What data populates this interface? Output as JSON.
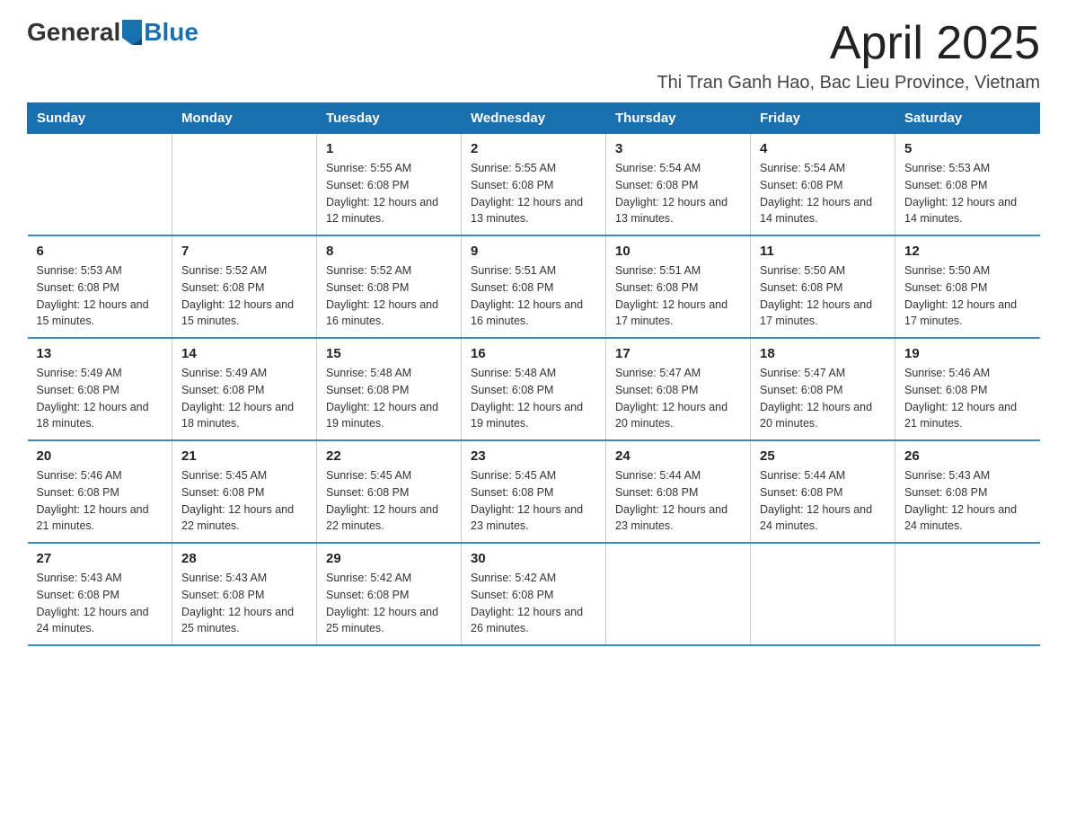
{
  "logo": {
    "general": "General",
    "blue": "Blue"
  },
  "header": {
    "month_title": "April 2025",
    "location": "Thi Tran Ganh Hao, Bac Lieu Province, Vietnam"
  },
  "days_of_week": [
    "Sunday",
    "Monday",
    "Tuesday",
    "Wednesday",
    "Thursday",
    "Friday",
    "Saturday"
  ],
  "weeks": [
    [
      {
        "day": "",
        "sunrise": "",
        "sunset": "",
        "daylight": ""
      },
      {
        "day": "",
        "sunrise": "",
        "sunset": "",
        "daylight": ""
      },
      {
        "day": "1",
        "sunrise": "Sunrise: 5:55 AM",
        "sunset": "Sunset: 6:08 PM",
        "daylight": "Daylight: 12 hours and 12 minutes."
      },
      {
        "day": "2",
        "sunrise": "Sunrise: 5:55 AM",
        "sunset": "Sunset: 6:08 PM",
        "daylight": "Daylight: 12 hours and 13 minutes."
      },
      {
        "day": "3",
        "sunrise": "Sunrise: 5:54 AM",
        "sunset": "Sunset: 6:08 PM",
        "daylight": "Daylight: 12 hours and 13 minutes."
      },
      {
        "day": "4",
        "sunrise": "Sunrise: 5:54 AM",
        "sunset": "Sunset: 6:08 PM",
        "daylight": "Daylight: 12 hours and 14 minutes."
      },
      {
        "day": "5",
        "sunrise": "Sunrise: 5:53 AM",
        "sunset": "Sunset: 6:08 PM",
        "daylight": "Daylight: 12 hours and 14 minutes."
      }
    ],
    [
      {
        "day": "6",
        "sunrise": "Sunrise: 5:53 AM",
        "sunset": "Sunset: 6:08 PM",
        "daylight": "Daylight: 12 hours and 15 minutes."
      },
      {
        "day": "7",
        "sunrise": "Sunrise: 5:52 AM",
        "sunset": "Sunset: 6:08 PM",
        "daylight": "Daylight: 12 hours and 15 minutes."
      },
      {
        "day": "8",
        "sunrise": "Sunrise: 5:52 AM",
        "sunset": "Sunset: 6:08 PM",
        "daylight": "Daylight: 12 hours and 16 minutes."
      },
      {
        "day": "9",
        "sunrise": "Sunrise: 5:51 AM",
        "sunset": "Sunset: 6:08 PM",
        "daylight": "Daylight: 12 hours and 16 minutes."
      },
      {
        "day": "10",
        "sunrise": "Sunrise: 5:51 AM",
        "sunset": "Sunset: 6:08 PM",
        "daylight": "Daylight: 12 hours and 17 minutes."
      },
      {
        "day": "11",
        "sunrise": "Sunrise: 5:50 AM",
        "sunset": "Sunset: 6:08 PM",
        "daylight": "Daylight: 12 hours and 17 minutes."
      },
      {
        "day": "12",
        "sunrise": "Sunrise: 5:50 AM",
        "sunset": "Sunset: 6:08 PM",
        "daylight": "Daylight: 12 hours and 17 minutes."
      }
    ],
    [
      {
        "day": "13",
        "sunrise": "Sunrise: 5:49 AM",
        "sunset": "Sunset: 6:08 PM",
        "daylight": "Daylight: 12 hours and 18 minutes."
      },
      {
        "day": "14",
        "sunrise": "Sunrise: 5:49 AM",
        "sunset": "Sunset: 6:08 PM",
        "daylight": "Daylight: 12 hours and 18 minutes."
      },
      {
        "day": "15",
        "sunrise": "Sunrise: 5:48 AM",
        "sunset": "Sunset: 6:08 PM",
        "daylight": "Daylight: 12 hours and 19 minutes."
      },
      {
        "day": "16",
        "sunrise": "Sunrise: 5:48 AM",
        "sunset": "Sunset: 6:08 PM",
        "daylight": "Daylight: 12 hours and 19 minutes."
      },
      {
        "day": "17",
        "sunrise": "Sunrise: 5:47 AM",
        "sunset": "Sunset: 6:08 PM",
        "daylight": "Daylight: 12 hours and 20 minutes."
      },
      {
        "day": "18",
        "sunrise": "Sunrise: 5:47 AM",
        "sunset": "Sunset: 6:08 PM",
        "daylight": "Daylight: 12 hours and 20 minutes."
      },
      {
        "day": "19",
        "sunrise": "Sunrise: 5:46 AM",
        "sunset": "Sunset: 6:08 PM",
        "daylight": "Daylight: 12 hours and 21 minutes."
      }
    ],
    [
      {
        "day": "20",
        "sunrise": "Sunrise: 5:46 AM",
        "sunset": "Sunset: 6:08 PM",
        "daylight": "Daylight: 12 hours and 21 minutes."
      },
      {
        "day": "21",
        "sunrise": "Sunrise: 5:45 AM",
        "sunset": "Sunset: 6:08 PM",
        "daylight": "Daylight: 12 hours and 22 minutes."
      },
      {
        "day": "22",
        "sunrise": "Sunrise: 5:45 AM",
        "sunset": "Sunset: 6:08 PM",
        "daylight": "Daylight: 12 hours and 22 minutes."
      },
      {
        "day": "23",
        "sunrise": "Sunrise: 5:45 AM",
        "sunset": "Sunset: 6:08 PM",
        "daylight": "Daylight: 12 hours and 23 minutes."
      },
      {
        "day": "24",
        "sunrise": "Sunrise: 5:44 AM",
        "sunset": "Sunset: 6:08 PM",
        "daylight": "Daylight: 12 hours and 23 minutes."
      },
      {
        "day": "25",
        "sunrise": "Sunrise: 5:44 AM",
        "sunset": "Sunset: 6:08 PM",
        "daylight": "Daylight: 12 hours and 24 minutes."
      },
      {
        "day": "26",
        "sunrise": "Sunrise: 5:43 AM",
        "sunset": "Sunset: 6:08 PM",
        "daylight": "Daylight: 12 hours and 24 minutes."
      }
    ],
    [
      {
        "day": "27",
        "sunrise": "Sunrise: 5:43 AM",
        "sunset": "Sunset: 6:08 PM",
        "daylight": "Daylight: 12 hours and 24 minutes."
      },
      {
        "day": "28",
        "sunrise": "Sunrise: 5:43 AM",
        "sunset": "Sunset: 6:08 PM",
        "daylight": "Daylight: 12 hours and 25 minutes."
      },
      {
        "day": "29",
        "sunrise": "Sunrise: 5:42 AM",
        "sunset": "Sunset: 6:08 PM",
        "daylight": "Daylight: 12 hours and 25 minutes."
      },
      {
        "day": "30",
        "sunrise": "Sunrise: 5:42 AM",
        "sunset": "Sunset: 6:08 PM",
        "daylight": "Daylight: 12 hours and 26 minutes."
      },
      {
        "day": "",
        "sunrise": "",
        "sunset": "",
        "daylight": ""
      },
      {
        "day": "",
        "sunrise": "",
        "sunset": "",
        "daylight": ""
      },
      {
        "day": "",
        "sunrise": "",
        "sunset": "",
        "daylight": ""
      }
    ]
  ]
}
